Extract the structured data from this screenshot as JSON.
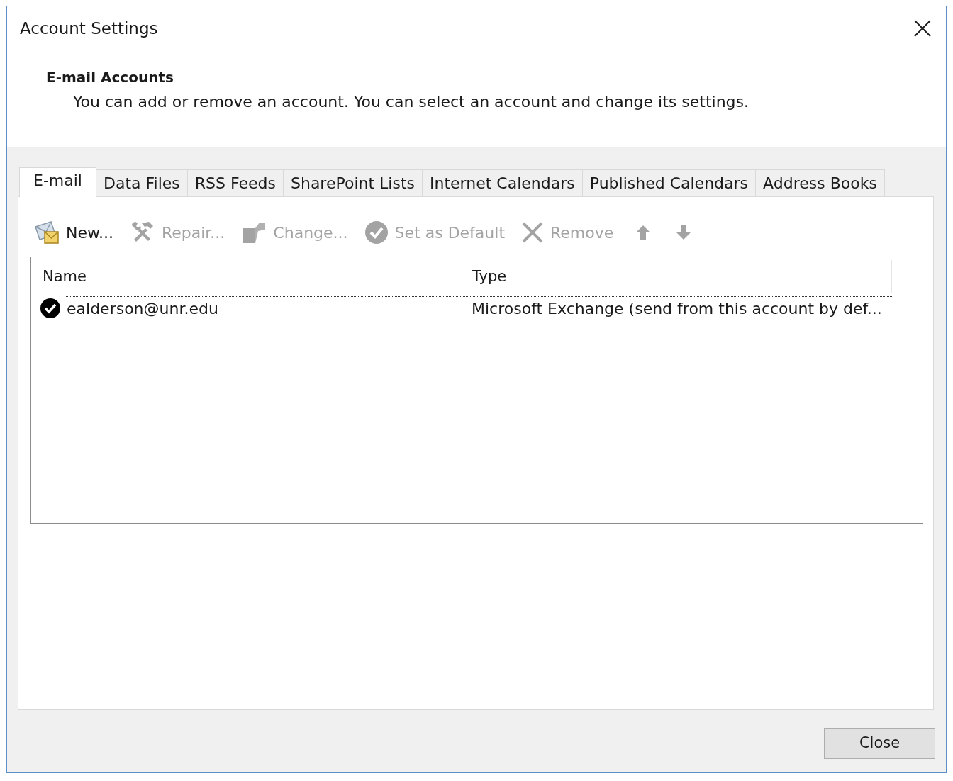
{
  "window": {
    "title": "Account Settings"
  },
  "header": {
    "heading": "E-mail Accounts",
    "description": "You can add or remove an account. You can select an account and change its settings."
  },
  "tabs": [
    {
      "label": "E-mail",
      "selected": true
    },
    {
      "label": "Data Files",
      "selected": false
    },
    {
      "label": "RSS Feeds",
      "selected": false
    },
    {
      "label": "SharePoint Lists",
      "selected": false
    },
    {
      "label": "Internet Calendars",
      "selected": false
    },
    {
      "label": "Published Calendars",
      "selected": false
    },
    {
      "label": "Address Books",
      "selected": false
    }
  ],
  "toolbar": [
    {
      "kind": "new",
      "label": "New...",
      "disabled": false
    },
    {
      "kind": "repair",
      "label": "Repair...",
      "disabled": true
    },
    {
      "kind": "change",
      "label": "Change...",
      "disabled": true
    },
    {
      "kind": "set_default",
      "label": "Set as Default",
      "disabled": true
    },
    {
      "kind": "remove",
      "label": "Remove",
      "disabled": true
    },
    {
      "kind": "move_up",
      "disabled": true
    },
    {
      "kind": "move_down",
      "disabled": true
    }
  ],
  "accounts": {
    "columns": [
      "Name",
      "Type"
    ],
    "rows": [
      {
        "name": "ealderson@unr.edu",
        "type": "Microsoft Exchange (send from this account by def...",
        "default": true,
        "selected": true
      }
    ]
  },
  "buttons": [
    {
      "label": "Close"
    }
  ]
}
